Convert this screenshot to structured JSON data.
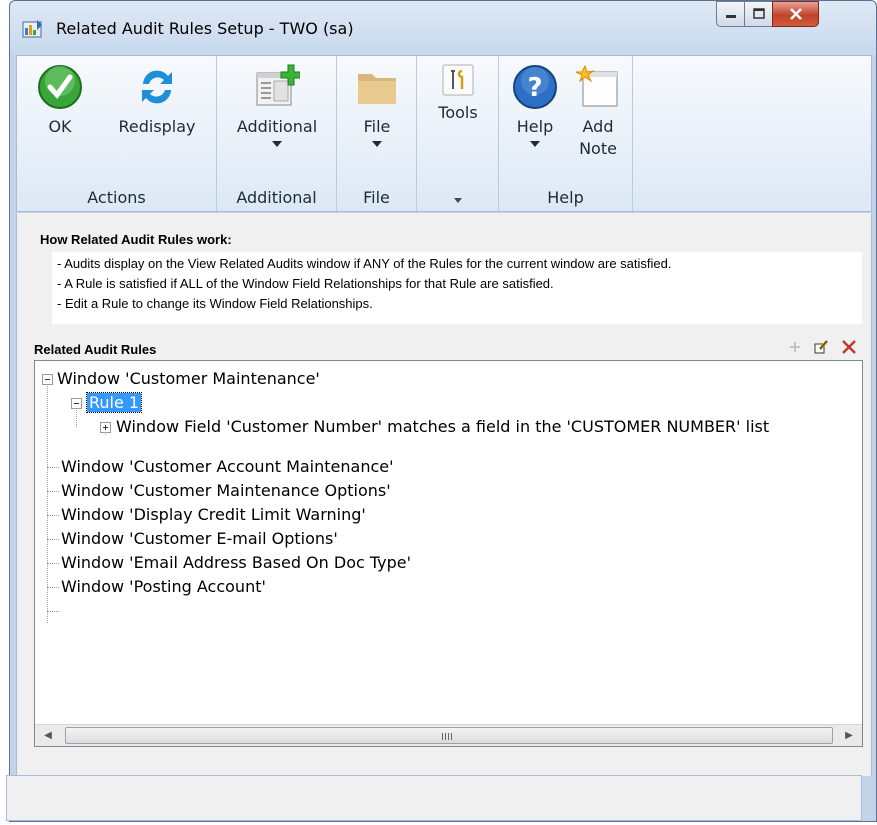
{
  "window": {
    "title": "Related Audit Rules Setup  -  TWO (sa)"
  },
  "ribbon": {
    "actions": {
      "ok": "OK",
      "redisplay": "Redisplay",
      "group": "Actions"
    },
    "additional": {
      "button": "Additional",
      "group": "Additional"
    },
    "file": {
      "button": "File",
      "group": "File"
    },
    "tools": {
      "button": "Tools"
    },
    "help": {
      "help": "Help",
      "add_note_1": "Add",
      "add_note_2": "Note",
      "group": "Help"
    }
  },
  "info": {
    "title": "How Related Audit Rules work:",
    "lines": [
      "- Audits display on the View Related Audits window if ANY of the Rules for the current window are satisfied.",
      "- A Rule is satisfied if ALL of the Window Field Relationships for that Rule are satisfied.",
      "- Edit a Rule to change its Window Field Relationships."
    ]
  },
  "rules": {
    "title": "Related Audit Rules",
    "tree": [
      "Window 'Customer Maintenance'",
      "Rule 1",
      "Window Field 'Customer Number' matches a field in the 'CUSTOMER NUMBER' list",
      "Window 'Customer Account Maintenance'",
      "Window 'Customer Maintenance Options'",
      "Window 'Display Credit Limit Warning'",
      "Window 'Customer E-mail Options'",
      "Window 'Email Address Based On Doc Type'",
      "Window 'Posting Account'"
    ]
  },
  "icons": {
    "app": "app-icon",
    "ok": "checkmark-icon",
    "redisplay": "refresh-icon",
    "additional": "window-add-icon",
    "file": "folder-icon",
    "tools": "tools-icon",
    "help": "help-icon",
    "note": "note-icon",
    "add": "add-icon",
    "edit": "edit-icon",
    "delete": "delete-icon"
  },
  "colors": {
    "selection": "#3399ff",
    "delete": "#c0392b",
    "ok_green": "#3aa63a",
    "help_blue": "#2d6fc4"
  }
}
